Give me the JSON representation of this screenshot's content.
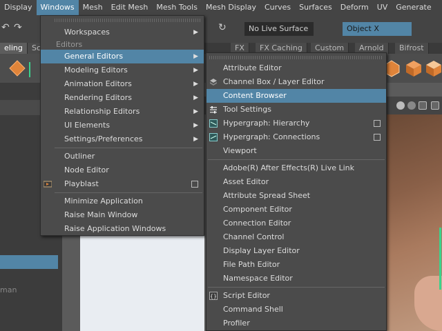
{
  "menubar": {
    "items": [
      "Display",
      "Windows",
      "Mesh",
      "Edit Mesh",
      "Mesh Tools",
      "Mesh Display",
      "Curves",
      "Surfaces",
      "Deform",
      "UV",
      "Generate"
    ],
    "active_index": 1
  },
  "statusline": {
    "live_surface": "No Live Surface",
    "object_mode": "Object X"
  },
  "shelf_tabs": [
    "eling",
    "Sc",
    "FX",
    "FX Caching",
    "Custom",
    "Arnold",
    "Bifrost"
  ],
  "left_panel": {
    "partial_text": "man"
  },
  "windows_menu": {
    "items": [
      {
        "label": "Workspaces",
        "submenu": true
      },
      {
        "section": "Editors"
      },
      {
        "label": "General Editors",
        "submenu": true,
        "highlighted": true
      },
      {
        "label": "Modeling Editors",
        "submenu": true
      },
      {
        "label": "Animation Editors",
        "submenu": true
      },
      {
        "label": "Rendering Editors",
        "submenu": true
      },
      {
        "label": "Relationship Editors",
        "submenu": true
      },
      {
        "label": "UI Elements",
        "submenu": true
      },
      {
        "label": "Settings/Preferences",
        "submenu": true
      },
      {
        "separator": true
      },
      {
        "label": "Outliner"
      },
      {
        "label": "Node Editor"
      },
      {
        "label": "Playblast",
        "option_box": true,
        "icon": "playblast-icon"
      },
      {
        "separator": true
      },
      {
        "label": "Minimize Application"
      },
      {
        "label": "Raise Main Window"
      },
      {
        "label": "Raise Application Windows"
      }
    ]
  },
  "general_editors_menu": {
    "items": [
      {
        "label": "Attribute Editor"
      },
      {
        "label": "Channel Box / Layer Editor",
        "icon": "channel-box-icon"
      },
      {
        "label": "Content Browser",
        "highlighted": true
      },
      {
        "label": "Tool Settings",
        "icon": "tool-settings-icon"
      },
      {
        "label": "Hypergraph: Hierarchy",
        "icon": "hypergraph-icon",
        "option_box": true
      },
      {
        "label": "Hypergraph: Connections",
        "icon": "hypergraph-icon",
        "option_box": true
      },
      {
        "label": "Viewport"
      },
      {
        "separator": true
      },
      {
        "label": "Adobe(R) After Effects(R) Live Link"
      },
      {
        "label": "Asset Editor"
      },
      {
        "label": "Attribute Spread Sheet"
      },
      {
        "label": "Component Editor"
      },
      {
        "label": "Connection Editor"
      },
      {
        "label": "Channel Control"
      },
      {
        "label": "Display Layer Editor"
      },
      {
        "label": "File Path Editor"
      },
      {
        "label": "Namespace Editor"
      },
      {
        "separator": true
      },
      {
        "label": "Script Editor",
        "icon": "script-editor-icon"
      },
      {
        "label": "Command Shell"
      },
      {
        "label": "Profiler"
      }
    ]
  },
  "colors": {
    "highlight": "#5285a6",
    "menu_bg": "#4b4b4b",
    "app_bg": "#444444",
    "selection_green": "#3cd28c"
  }
}
